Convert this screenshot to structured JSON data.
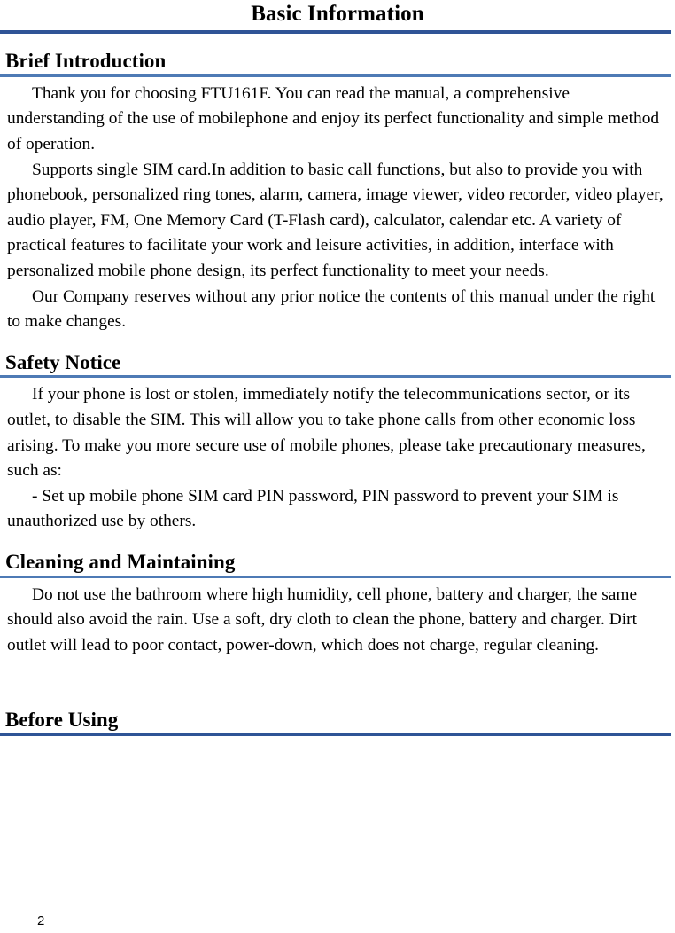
{
  "document": {
    "title": "Basic Information",
    "page_number": "2"
  },
  "colors": {
    "title_rule": "#2f5496",
    "section_rule": "#4e7ab5",
    "text": "#000000",
    "background": "#ffffff"
  },
  "sections": [
    {
      "id": "brief-introduction",
      "heading": "Brief Introduction",
      "rule_style": "light",
      "paragraphs": [
        "Thank you for choosing FTU161F. You can read the manual, a comprehensive understanding of the use of mobilephone and enjoy its perfect functionality and simple method of operation.",
        "Supports single SIM card.In addition to basic call functions, but also to provide you with phonebook, personalized ring tones, alarm, camera, image viewer, video recorder, video player, audio player, FM, One Memory Card (T-Flash card), calculator, calendar etc. A variety of practical features to facilitate your work and leisure activities, in addition, interface with personalized mobile phone design, its perfect functionality to meet your needs.",
        "Our Company reserves without any prior notice the contents of this manual under the right to make changes."
      ]
    },
    {
      "id": "safety-notice",
      "heading": "Safety Notice",
      "rule_style": "light",
      "paragraphs": [
        "If your phone is lost or stolen, immediately notify the telecommunications sector, or its outlet, to disable the SIM. This will allow you to take phone calls from other economic loss arising. To make you more secure use of mobile phones, please take precautionary measures, such as:",
        "- Set up mobile phone SIM card PIN password, PIN password to prevent your SIM is unauthorized use by others."
      ]
    },
    {
      "id": "cleaning-and-maintaining",
      "heading": "Cleaning and Maintaining",
      "rule_style": "light",
      "paragraphs": [
        "Do not use the bathroom where high humidity, cell phone, battery and charger, the same should also avoid the rain. Use a soft, dry cloth to clean the phone, battery and charger. Dirt outlet will lead to poor contact, power-down, which does not charge, regular cleaning."
      ]
    },
    {
      "id": "before-using",
      "heading": "Before Using",
      "rule_style": "heavy",
      "paragraphs": []
    }
  ]
}
